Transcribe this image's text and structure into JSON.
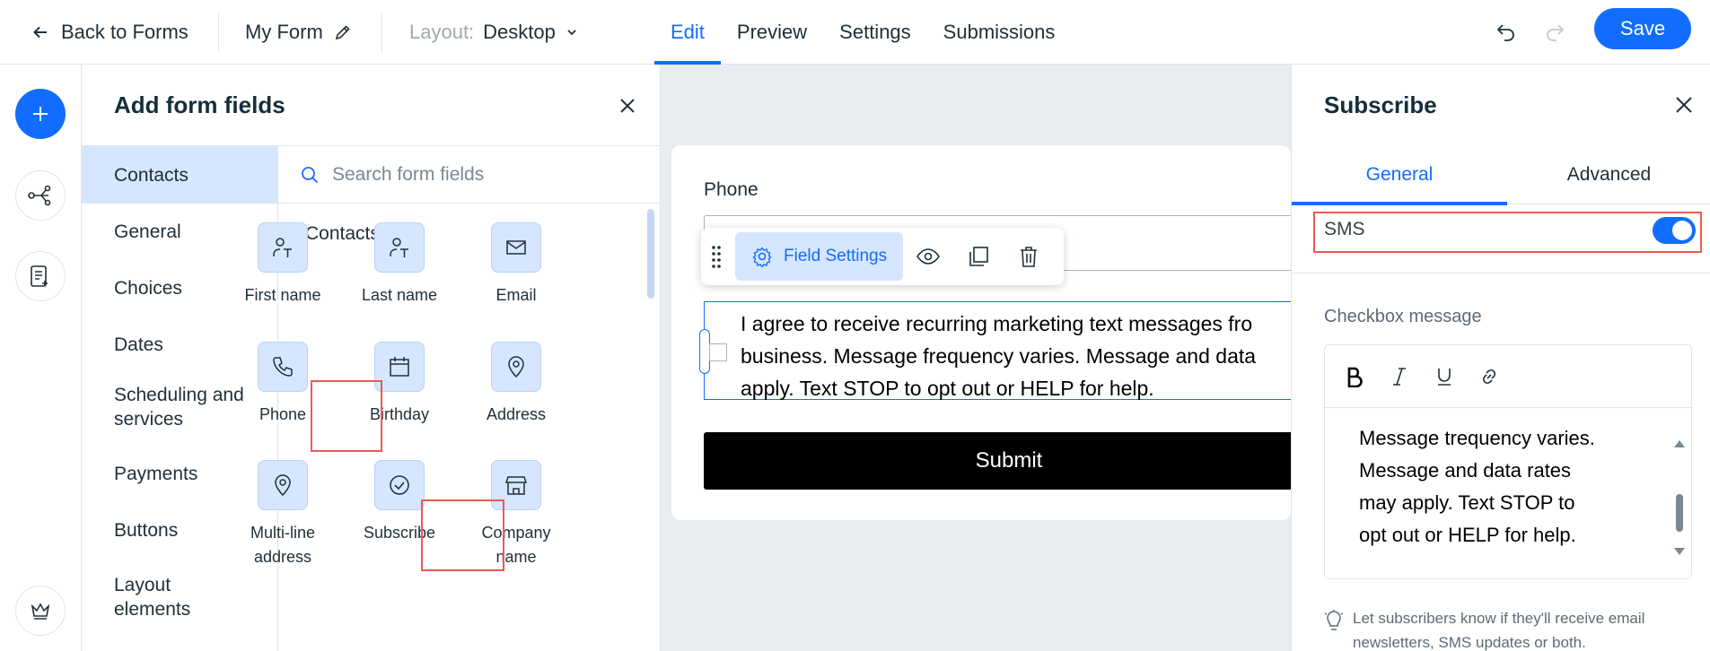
{
  "topbar": {
    "back_label": "Back to Forms",
    "form_name": "My Form",
    "layout_label": "Layout:",
    "layout_value": "Desktop",
    "tabs": [
      {
        "label": "Edit",
        "active": true
      },
      {
        "label": "Preview",
        "active": false
      },
      {
        "label": "Settings",
        "active": false
      },
      {
        "label": "Submissions",
        "active": false
      }
    ],
    "save_label": "Save"
  },
  "rail": {
    "icons": [
      "plus-icon",
      "connections-icon",
      "form-list-icon",
      "crown-icon"
    ]
  },
  "add_panel": {
    "title": "Add form fields",
    "categories": [
      {
        "label": "Contacts",
        "active": true
      },
      {
        "label": "General"
      },
      {
        "label": "Choices"
      },
      {
        "label": "Dates"
      },
      {
        "label": "Scheduling and services"
      },
      {
        "label": "Payments"
      },
      {
        "label": "Buttons"
      },
      {
        "label": "Layout elements"
      }
    ],
    "search_placeholder": "Search form fields",
    "section_title": "Contacts",
    "fields": [
      {
        "label": "First name",
        "icon": "person-text-icon"
      },
      {
        "label": "Last name",
        "icon": "person-text-icon"
      },
      {
        "label": "Email",
        "icon": "envelope-icon"
      },
      {
        "label": "Phone",
        "icon": "phone-icon",
        "highlighted": true
      },
      {
        "label": "Birthday",
        "icon": "calendar-icon"
      },
      {
        "label": "Address",
        "icon": "location-pin-icon"
      },
      {
        "label": "Multi-line address",
        "icon": "location-pin-icon"
      },
      {
        "label": "Subscribe",
        "icon": "check-circle-icon",
        "highlighted": true
      },
      {
        "label": "Company name",
        "icon": "store-icon"
      }
    ]
  },
  "canvas": {
    "phone_label": "Phone",
    "toolbar": {
      "field_settings_label": "Field Settings",
      "icons": [
        "drag-handle-icon",
        "gear-icon",
        "eye-icon",
        "duplicate-icon",
        "trash-icon"
      ]
    },
    "consent_lines": [
      "I agree to receive recurring marketing text messages fro",
      "business. Message frequency varies. Message and data",
      "apply. Text STOP to opt out or HELP for help."
    ],
    "submit_label": "Submit"
  },
  "right_panel": {
    "title": "Subscribe",
    "tabs": [
      {
        "label": "General",
        "active": true
      },
      {
        "label": "Advanced",
        "active": false
      }
    ],
    "sms_label": "SMS",
    "sms_enabled": true,
    "checkbox_message_label": "Checkbox message",
    "editor_tools": [
      "bold-icon",
      "italic-icon",
      "underline-icon",
      "link-icon"
    ],
    "editor_lines": [
      "Message trequency varies.",
      "Message and data rates",
      "may apply. Text STOP to",
      "opt out or HELP for help."
    ],
    "tip_lines": [
      "Let subscribers know if they'll receive email",
      "newsletters, SMS updates or both."
    ]
  },
  "colors": {
    "accent": "#116dff",
    "accent_light": "#d6e6fe",
    "highlight": "#ee5951",
    "canvas_bg": "#e8ecf1"
  }
}
